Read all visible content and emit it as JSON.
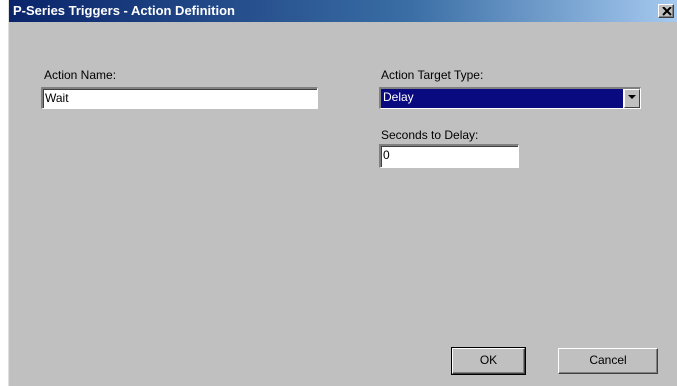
{
  "window": {
    "title": "P-Series Triggers - Action Definition"
  },
  "form": {
    "action_name_label": "Action Name:",
    "action_name_value": "Wait",
    "target_type_label": "Action Target Type:",
    "target_type_value": "Delay",
    "seconds_label": "Seconds to Delay:",
    "seconds_value": "0"
  },
  "buttons": {
    "ok_label": "OK",
    "cancel_label": "Cancel"
  },
  "icons": {
    "close": "close-icon",
    "dropdown": "chevron-down-icon"
  },
  "colors": {
    "title_bar_start": "#0a246a",
    "title_bar_end": "#a6caf0",
    "selection": "#0a0a80",
    "face": "#c0c0c0"
  }
}
